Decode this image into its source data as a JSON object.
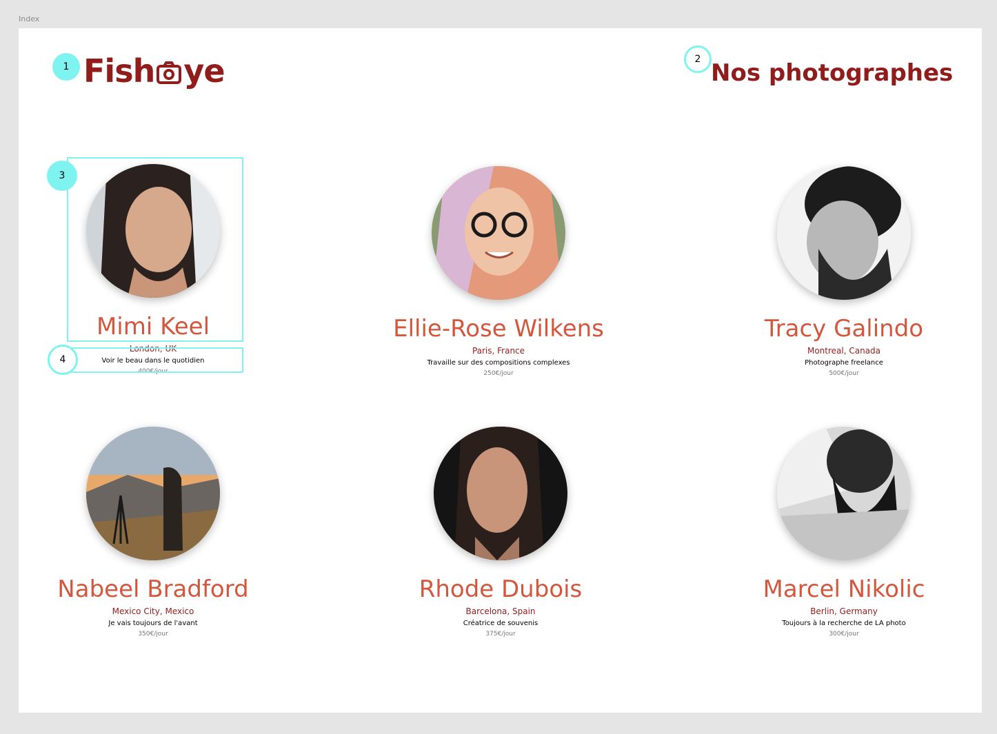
{
  "frame": {
    "label": "Index"
  },
  "header": {
    "logo_text_left": "Fish",
    "logo_text_right": "ye",
    "heading": "Nos photographes"
  },
  "annotations": [
    "1",
    "2",
    "3",
    "4"
  ],
  "photographers": [
    {
      "name": "Mimi Keel",
      "location": "London, UK",
      "tagline": "Voir le beau dans le quotidien",
      "price": "400€/jour"
    },
    {
      "name": "Ellie-Rose Wilkens",
      "location": "Paris, France",
      "tagline": "Travaille sur des compositions complexes",
      "price": "250€/jour"
    },
    {
      "name": "Tracy Galindo",
      "location": "Montreal, Canada",
      "tagline": "Photographe freelance",
      "price": "500€/jour"
    },
    {
      "name": "Nabeel Bradford",
      "location": "Mexico City, Mexico",
      "tagline": "Je vais toujours de l'avant",
      "price": "350€/jour"
    },
    {
      "name": "Rhode Dubois",
      "location": "Barcelona, Spain",
      "tagline": "Créatrice de souvenis",
      "price": "375€/jour"
    },
    {
      "name": "Marcel Nikolic",
      "location": "Berlin, Germany",
      "tagline": "Toujours à la recherche de LA photo",
      "price": "300€/jour"
    }
  ],
  "colors": {
    "brand": "#901c1c",
    "name": "#d3573c",
    "annotation": "#7ff3f0"
  }
}
